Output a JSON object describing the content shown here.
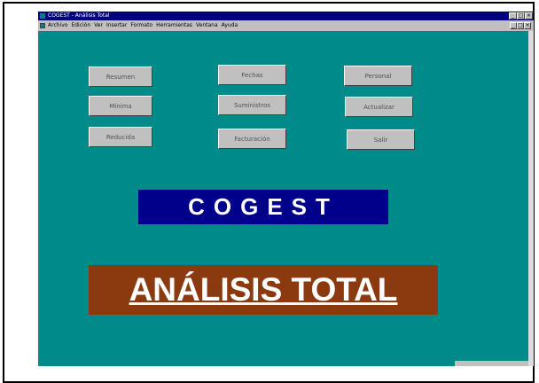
{
  "window": {
    "title": "COGEST - Análisis Total",
    "titlebar_buttons": [
      "_",
      "□",
      "×"
    ],
    "mdi_buttons": [
      "_",
      "□",
      "×"
    ]
  },
  "menu": [
    "Archivo",
    "Edición",
    "Ver",
    "Insertar",
    "Formato",
    "Herramientas",
    "Ventana",
    "Ayuda"
  ],
  "buttons": {
    "resumen": "Resumen",
    "minima": "Mínima",
    "reducida": "Reducida",
    "fechas": "Fechas",
    "suministros": "Suministros",
    "facturacion": "Facturación",
    "personal": "Personal",
    "actualizar": "Actualizar",
    "salir": "Salir"
  },
  "banners": {
    "cogest": "COGEST",
    "analisis": "ANÁLISIS TOTAL"
  },
  "colors": {
    "form_background": "#008b8b",
    "cogest_background": "#00008b",
    "analisis_background": "#8b3a0f",
    "titlebar": "#000080"
  }
}
